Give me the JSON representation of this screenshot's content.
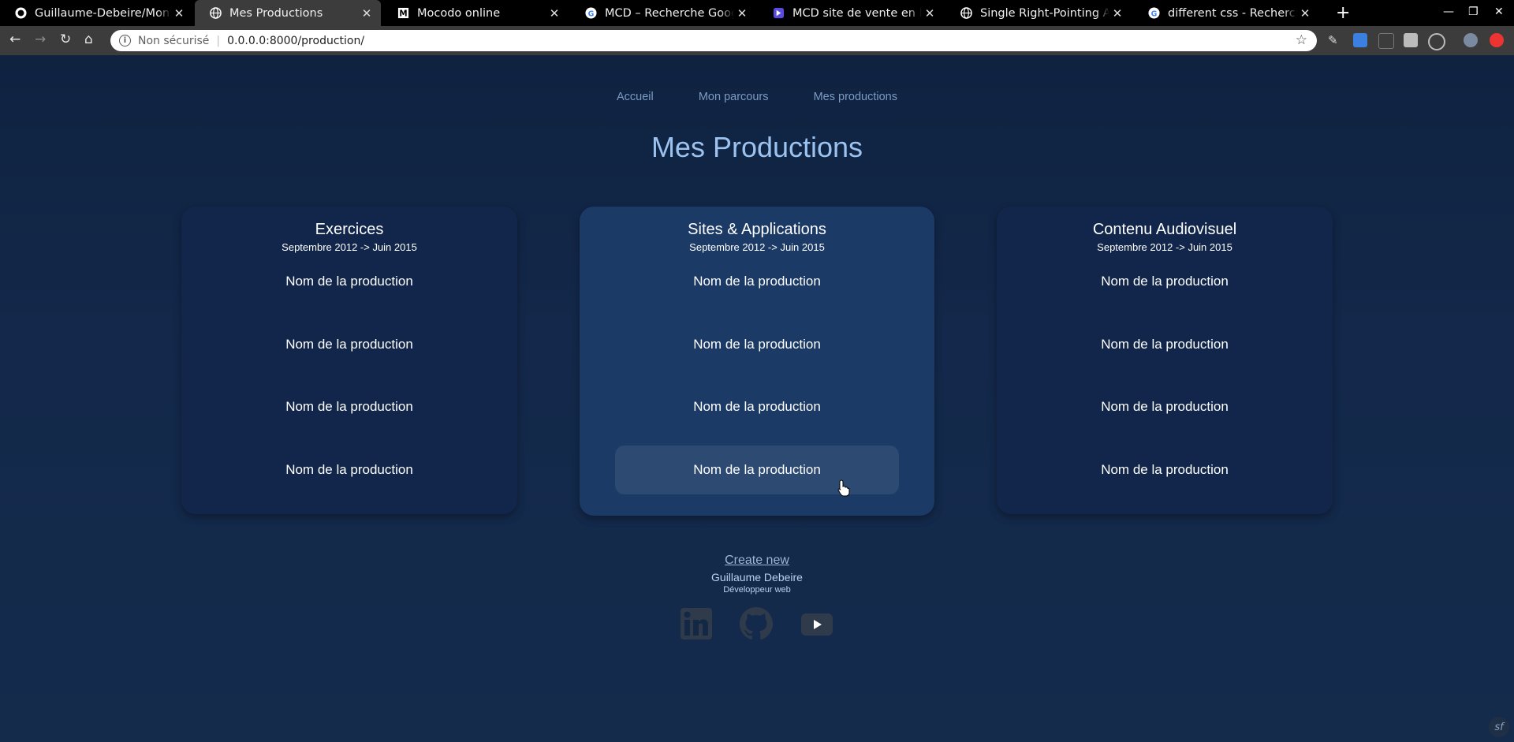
{
  "browser": {
    "tabs": [
      {
        "title": "Guillaume-Debeire/MonSite",
        "icon": "github-icon",
        "active": false
      },
      {
        "title": "Mes Productions",
        "icon": "globe-icon",
        "active": true
      },
      {
        "title": "Mocodo online",
        "icon": "mocodo-icon",
        "active": false
      },
      {
        "title": "MCD – Recherche Google",
        "icon": "google-icon",
        "active": false
      },
      {
        "title": "MCD site de vente en ligne",
        "icon": "app-icon",
        "active": false
      },
      {
        "title": "Single Right-Pointing Angle",
        "icon": "globe-icon",
        "active": false
      },
      {
        "title": "different css - Recherche G",
        "icon": "google-icon",
        "active": false
      }
    ],
    "new_tab_label": "+",
    "address": {
      "security_label": "Non sécurisé",
      "url": "0.0.0.0:8000/production/"
    }
  },
  "nav": {
    "items": [
      "Accueil",
      "Mon parcours",
      "Mes productions"
    ]
  },
  "page_title": "Mes Productions",
  "cards": [
    {
      "title": "Exercices",
      "subtitle": "Septembre 2012 -> Juin 2015",
      "items": [
        "Nom de la production",
        "Nom de la production",
        "Nom de la production",
        "Nom de la production"
      ]
    },
    {
      "title": "Sites & Applications",
      "subtitle": "Septembre 2012 -> Juin 2015",
      "items": [
        "Nom de la production",
        "Nom de la production",
        "Nom de la production",
        "Nom de la production"
      ]
    },
    {
      "title": "Contenu Audiovisuel",
      "subtitle": "Septembre 2012 -> Juin 2015",
      "items": [
        "Nom de la production",
        "Nom de la production",
        "Nom de la production",
        "Nom de la production"
      ]
    }
  ],
  "footer": {
    "create_link": "Create new",
    "name": "Guillaume Debeire",
    "role": "Développeur web",
    "social_icons": [
      "linkedin-icon",
      "github-icon",
      "youtube-icon"
    ]
  },
  "colors": {
    "page_bg": "#132844",
    "card_bg": "#11264a",
    "card_active_bg": "#1b3a66",
    "item_hover_bg": "#2d4a72",
    "title_color": "#9cc2ef",
    "nav_link": "#7b9cc4"
  }
}
